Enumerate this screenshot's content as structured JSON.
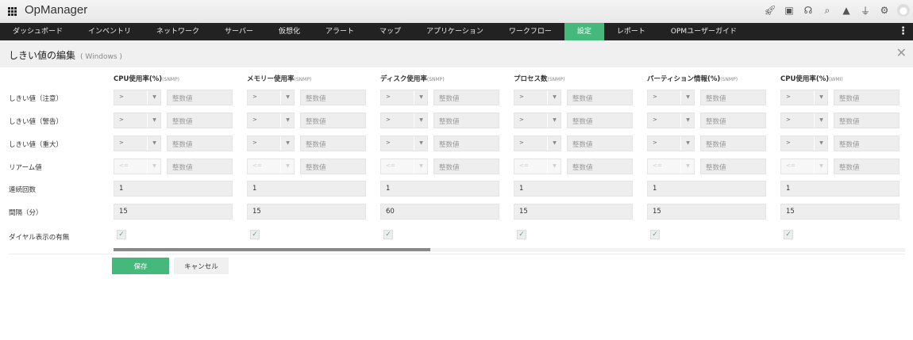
{
  "app": {
    "name": "OpManager"
  },
  "header_icons": [
    "rocket-icon",
    "video-icon",
    "headset-icon",
    "search-icon",
    "bell-icon",
    "plug-icon",
    "gear-icon",
    "avatar-icon"
  ],
  "nav": [
    "ダッシュボード",
    "インベントリ",
    "ネットワーク",
    "サーバー",
    "仮想化",
    "アラート",
    "マップ",
    "アプリケーション",
    "ワークフロー",
    "設定",
    "レポート",
    "OPMユーザーガイド"
  ],
  "nav_active": "設定",
  "page": {
    "title": "しきい値の編集",
    "subtitle": "( Windows )"
  },
  "row_labels": [
    "しきい値（注意）",
    "しきい値（警告）",
    "しきい値（重大）",
    "リアーム値",
    "連続回数",
    "間隔（分）",
    "ダイヤル表示の有無"
  ],
  "columns": [
    {
      "name": "CPU使用率(%)",
      "proto": "(SNMP)",
      "ops": [
        ">",
        ">",
        ">",
        "<="
      ],
      "placeholder": "整数値",
      "count": "1",
      "interval": "15",
      "dial": true
    },
    {
      "name": "メモリー使用率",
      "proto": "(SNMP)",
      "ops": [
        ">",
        ">",
        ">",
        "<="
      ],
      "placeholder": "整数値",
      "count": "1",
      "interval": "15",
      "dial": true
    },
    {
      "name": "ディスク使用率",
      "proto": "(SNMP)",
      "ops": [
        ">",
        ">",
        ">",
        "<="
      ],
      "placeholder": "整数値",
      "count": "1",
      "interval": "60",
      "dial": true
    },
    {
      "name": "プロセス数",
      "proto": "(SNMP)",
      "ops": [
        ">",
        ">",
        ">",
        "<="
      ],
      "placeholder": "整数値",
      "count": "1",
      "interval": "15",
      "dial": true
    },
    {
      "name": "パーティション情報(%)",
      "proto": "(SNMP)",
      "ops": [
        ">",
        ">",
        ">",
        "<="
      ],
      "placeholder": "整数値",
      "count": "1",
      "interval": "15",
      "dial": true
    },
    {
      "name": "CPU使用率(%)",
      "proto": "(WMI)",
      "ops": [
        ">",
        ">",
        ">",
        "<="
      ],
      "placeholder": "整数値",
      "count": "1",
      "interval": "15",
      "dial": true
    }
  ],
  "buttons": {
    "save": "保存",
    "cancel": "キャンセル"
  },
  "scroll_fraction": 0.4,
  "colors": {
    "accent": "#45b97c",
    "nav_bg": "#222222"
  }
}
